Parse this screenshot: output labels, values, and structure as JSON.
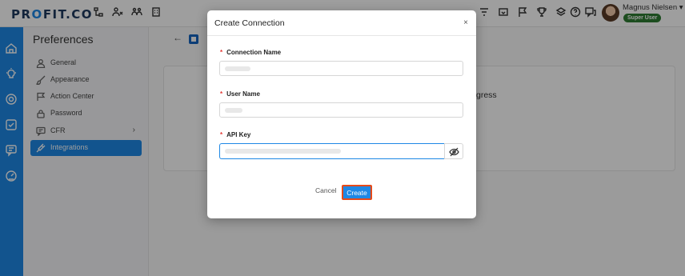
{
  "app": {
    "logo_text_a": "PR",
    "logo_text_o": "O",
    "logo_text_b": "FIT.CO"
  },
  "topbar": {
    "icons": [
      "org-chart-icon",
      "people-icon",
      "team-icon",
      "building-icon",
      "filter-icon",
      "inbox-icon",
      "flag-icon",
      "trophy-icon",
      "layers-icon",
      "help-icon",
      "chat-icon"
    ],
    "user": {
      "name": "Magnus Nielsen",
      "dropdown": "▾",
      "role_badge": "Super User"
    }
  },
  "rail": {
    "icons": [
      "home-icon",
      "lightbulb-icon",
      "target-icon",
      "checklist-icon",
      "feedback-icon",
      "gauge-icon"
    ]
  },
  "preferences": {
    "title": "Preferences",
    "collapse_glyph": "‹",
    "items": [
      {
        "label": "General",
        "icon": "user-icon",
        "active": false
      },
      {
        "label": "Appearance",
        "icon": "brush-icon",
        "active": false
      },
      {
        "label": "Action Center",
        "icon": "flag-icon",
        "active": false
      },
      {
        "label": "Password",
        "icon": "lock-icon",
        "active": false
      },
      {
        "label": "CFR",
        "icon": "chat-icon",
        "active": false,
        "chevron": "›"
      },
      {
        "label": "Integrations",
        "icon": "plug-icon",
        "active": true
      }
    ]
  },
  "main": {
    "back_glyph": "←",
    "card_text": "gress"
  },
  "modal": {
    "title": "Create Connection",
    "close_glyph": "×",
    "required_mark": "*",
    "fields": [
      {
        "label": "Connection Name"
      },
      {
        "label": "User Name"
      },
      {
        "label": "API Key"
      }
    ],
    "cancel_label": "Cancel",
    "create_label": "Create"
  },
  "colors": {
    "accent": "#1e88e5",
    "badge": "#2e7d32",
    "create_outline": "#e64a19",
    "required": "#e53935"
  }
}
